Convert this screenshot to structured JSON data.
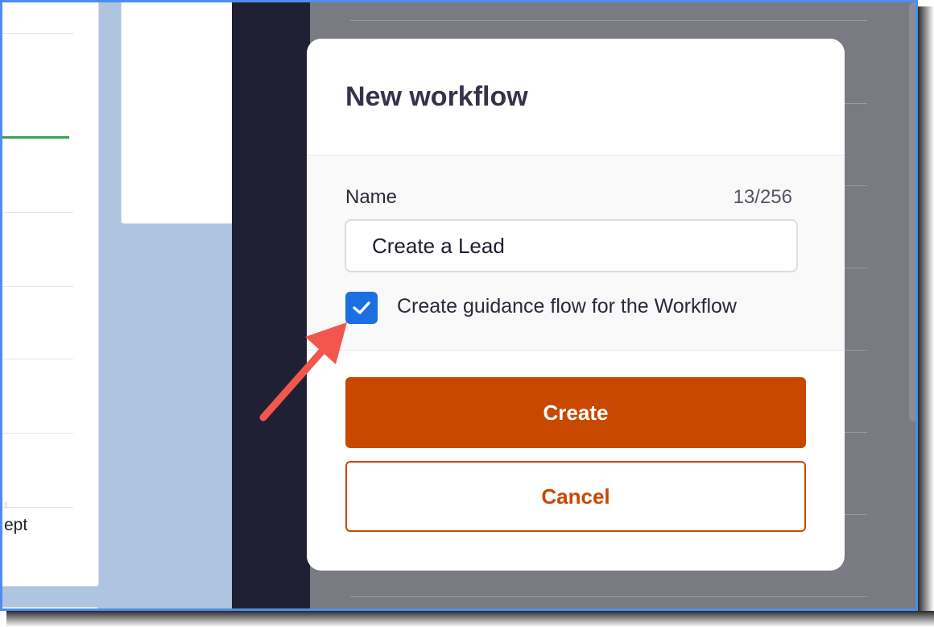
{
  "background": {
    "axis_fragment": "ept"
  },
  "modal": {
    "title": "New workflow",
    "name_label": "Name",
    "name_counter": "13/256",
    "name_value": "Create a Lead",
    "guidance_checkbox_checked": true,
    "guidance_label": "Create guidance flow for the Workflow",
    "create_label": "Create",
    "cancel_label": "Cancel"
  },
  "colors": {
    "primary": "#c84800",
    "checkbox": "#1c6fe0",
    "overlay": "#7a7a82",
    "sidebar": "#1f2033",
    "frame_border": "#4a8ff0",
    "arrow": "#f2564d"
  },
  "icons": {
    "checkbox_icon": "check-icon",
    "callout": "arrow-icon"
  }
}
